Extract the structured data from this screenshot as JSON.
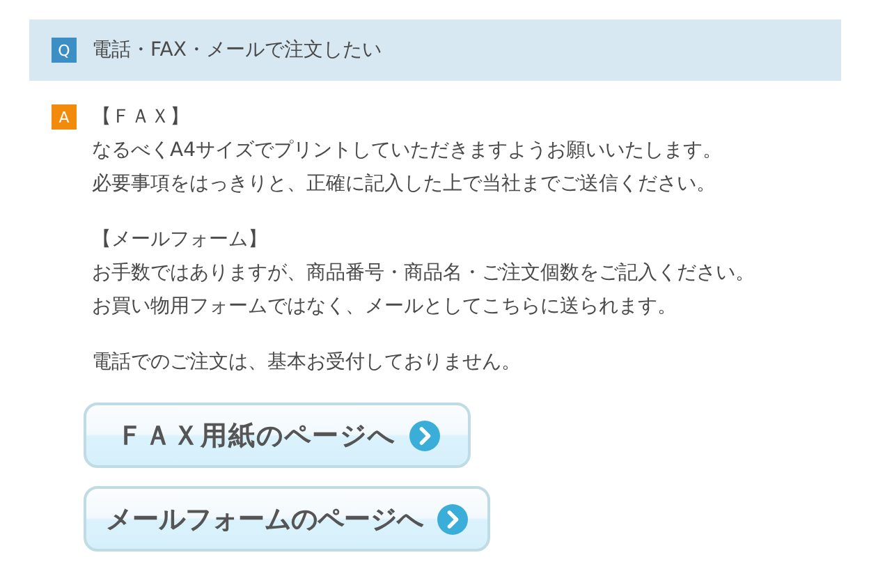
{
  "question": {
    "badge": "Q",
    "text": "電話・FAX・メールで注文したい"
  },
  "answer": {
    "badge": "A",
    "sections": [
      {
        "heading": "【ＦＡＸ】",
        "lines": [
          "なるべくA4サイズでプリントしていただきますようお願いいたします。",
          "必要事項をはっきりと、正確に記入した上で当社までご送信ください。"
        ]
      },
      {
        "heading": "【メールフォーム】",
        "lines": [
          "お手数ではありますが、商品番号・商品名・ご注文個数をご記入ください。",
          "お買い物用フォームではなく、メールとしてこちらに送られます。"
        ]
      },
      {
        "lines": [
          "電話でのご注文は、基本お受付しておりません。"
        ]
      }
    ]
  },
  "buttons": [
    {
      "label": "ＦＡＸ用紙のページへ",
      "kind": "wide"
    },
    {
      "label": "メールフォームのページへ",
      "kind": "normal"
    }
  ]
}
